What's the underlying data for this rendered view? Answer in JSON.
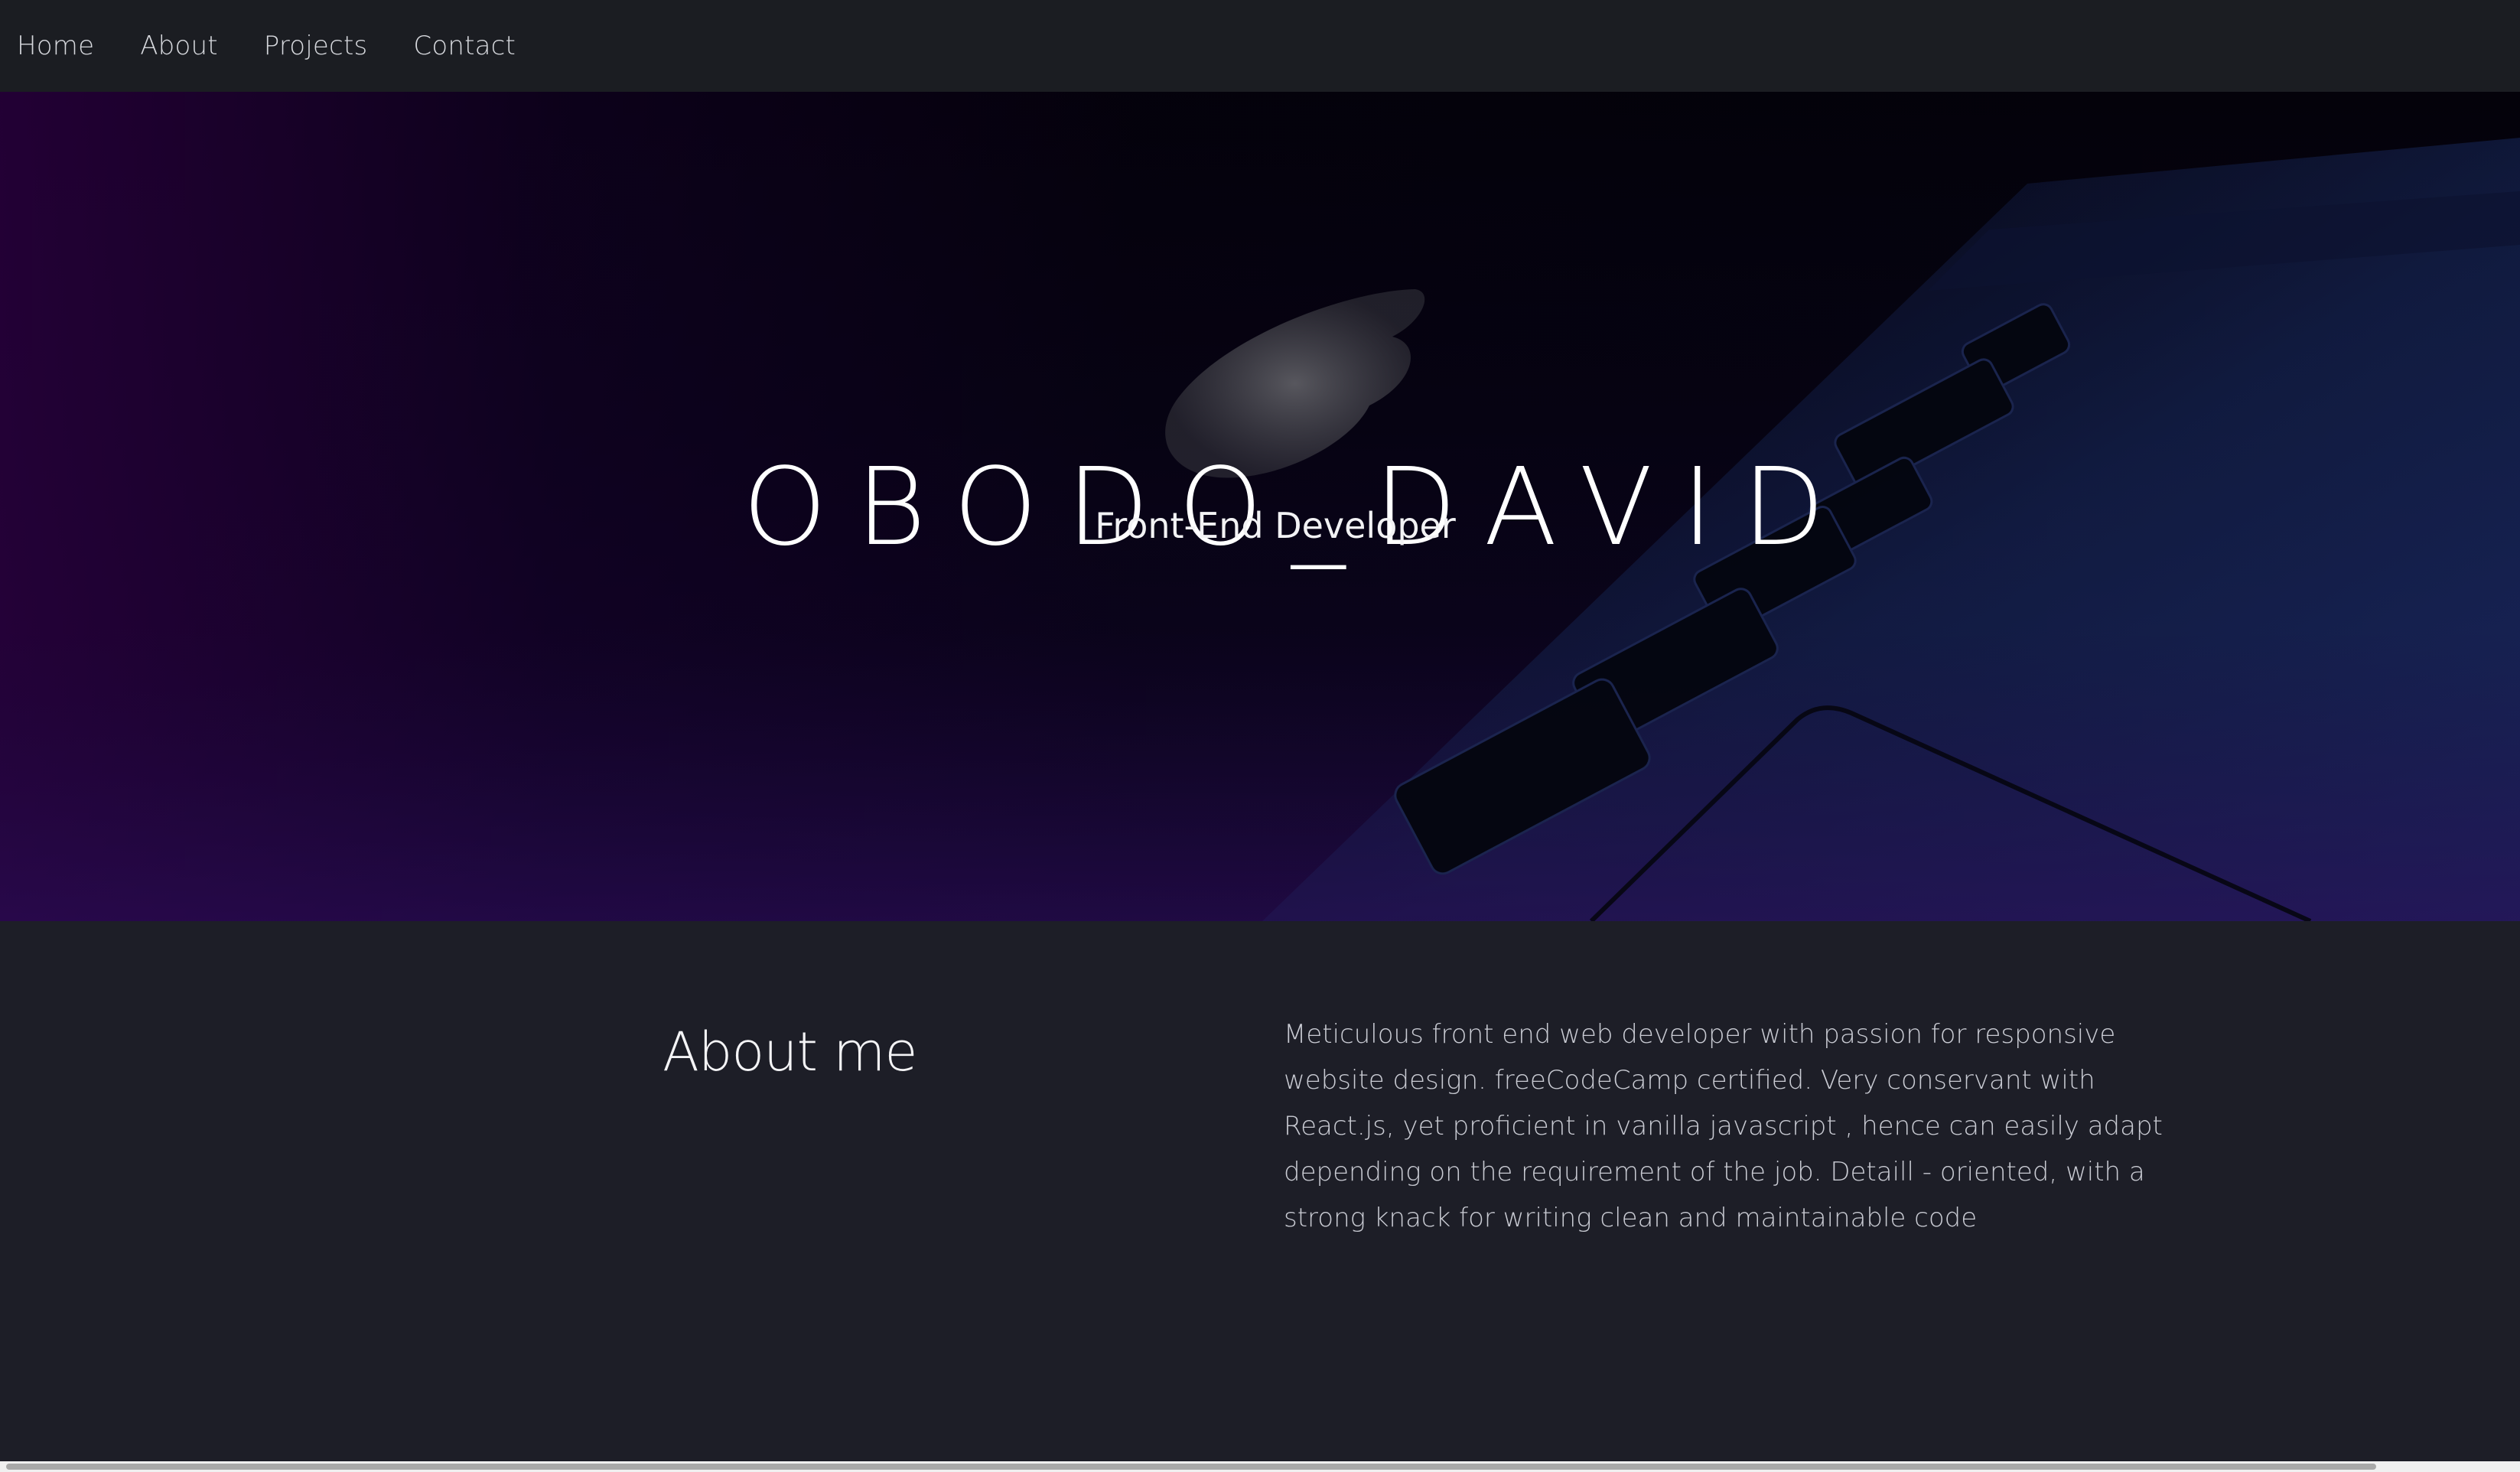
{
  "nav": {
    "items": [
      {
        "label": "Home"
      },
      {
        "label": "About"
      },
      {
        "label": "Projects"
      },
      {
        "label": "Contact"
      }
    ]
  },
  "hero": {
    "title": "OBODO_DAVID",
    "subtitle": "Front-End Developer",
    "background": "laptop-keyboard-photo"
  },
  "about": {
    "heading": "About me",
    "text": "Meticulous front end web developer with passion for responsive website design. freeCodeCamp certified. Very conservant with React.js, yet proficient in vanilla javascript , hence can easily adapt depending on the requirement of the job. Detaill - oriented, with a strong knack for writing clean and maintainable code"
  },
  "colors": {
    "nav_bg": "#1b1d22",
    "page_bg": "#1d1e27",
    "hero_accent_purple": "#2a0040",
    "hero_accent_blue": "#0b1a4a"
  }
}
